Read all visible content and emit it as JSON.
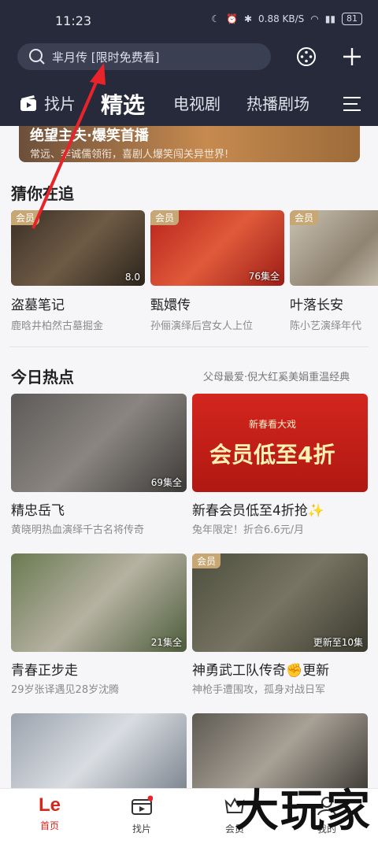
{
  "status": {
    "time": "11:23",
    "net": "0.88 KB/S",
    "battery": "81"
  },
  "search": {
    "placeholder": "芈月传 [限时免费看]"
  },
  "nav": {
    "items": [
      "找片",
      "精选",
      "电视剧",
      "热播剧场"
    ]
  },
  "banner": {
    "title": "绝望主夫·爆笑首播",
    "subtitle": "常远、李诚儒领衔，喜剧人爆笑闯关异世界!"
  },
  "sections": {
    "following": {
      "title": "猜你在追",
      "cards": [
        {
          "badge": "会员",
          "corner": "8.0",
          "title": "盗墓笔记",
          "subtitle": "鹿晗井柏然古墓掘金"
        },
        {
          "badge": "会员",
          "corner": "76集全",
          "title": "甄嬛传",
          "subtitle": "孙俪演绎后宫女人上位"
        },
        {
          "badge": "会员",
          "corner": "",
          "title": "叶落长安",
          "subtitle": "陈小艺演绎年代"
        }
      ]
    },
    "hot": {
      "title": "今日热点",
      "subtitle": "父母最爱·倪大红奚美娟重温经典",
      "cards": [
        {
          "badge": "",
          "corner": "69集全",
          "title": "精忠岳飞",
          "subtitle": "黄晓明热血演绎千古名将传奇"
        },
        {
          "badge": "",
          "corner": "",
          "title": "新春会员低至4折抢✨",
          "subtitle": "兔年限定！折合6.6元/月",
          "promo_top": "新春看大戏",
          "promo_main": "会员低至4折"
        },
        {
          "badge": "",
          "corner": "21集全",
          "title": "青春正步走",
          "subtitle": "29岁张译遇见28岁沈腾"
        },
        {
          "badge": "会员",
          "corner": "更新至10集",
          "title": "神勇武工队传奇✊更新",
          "subtitle": "神枪手遭围攻，孤身对战日军"
        }
      ]
    }
  },
  "tabbar": {
    "items": [
      "首页",
      "找片",
      "会员",
      "我的"
    ],
    "logo": "Le"
  },
  "watermark": "大玩家",
  "colors": {
    "header": "#262a3a",
    "accent": "#d7261e",
    "badge": "#c7a774"
  }
}
